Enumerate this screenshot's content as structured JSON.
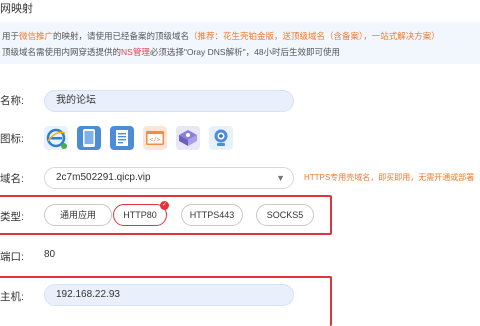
{
  "header": {
    "title": "网映射"
  },
  "notice": {
    "line1_a": "用于",
    "line1_link": "微信推广",
    "line1_b": "的映射，请使用已经备案的顶级域名",
    "line1_tip": "（推荐：花生壳铂金版，送顶级域名（含备案），一站式解决方案）",
    "line2_a": "顶级域名需使用内网穿透提供的",
    "line2_ns": "NS管理",
    "line2_b": "必须选择\"Oray DNS解析\"，48小时后生效即可使用"
  },
  "form": {
    "name": {
      "label": "名称:",
      "value": "我的论坛"
    },
    "icon": {
      "label": "图标:",
      "icons": [
        "ie-browser-icon",
        "tablet-icon",
        "document-icon",
        "code-window-icon",
        "3d-box-icon",
        "webcam-icon"
      ]
    },
    "domain": {
      "label": "域名:",
      "value": "2c7m502291.qicp.vip",
      "hint": "HTTPS专用壳域名，即买即用，无需开通或部署"
    },
    "type": {
      "label": "类型:",
      "options": [
        "通用应用",
        "HTTP80",
        "HTTPS443",
        "SOCKS5"
      ],
      "selected": "HTTP80"
    },
    "port": {
      "label": "端口:",
      "value": "80"
    },
    "host": {
      "label": "主机:",
      "value": "192.168.22.93"
    }
  },
  "colors": {
    "accent_red": "#e0333a",
    "accent_orange": "#f0782b",
    "input_bg": "#e9f0fc"
  }
}
